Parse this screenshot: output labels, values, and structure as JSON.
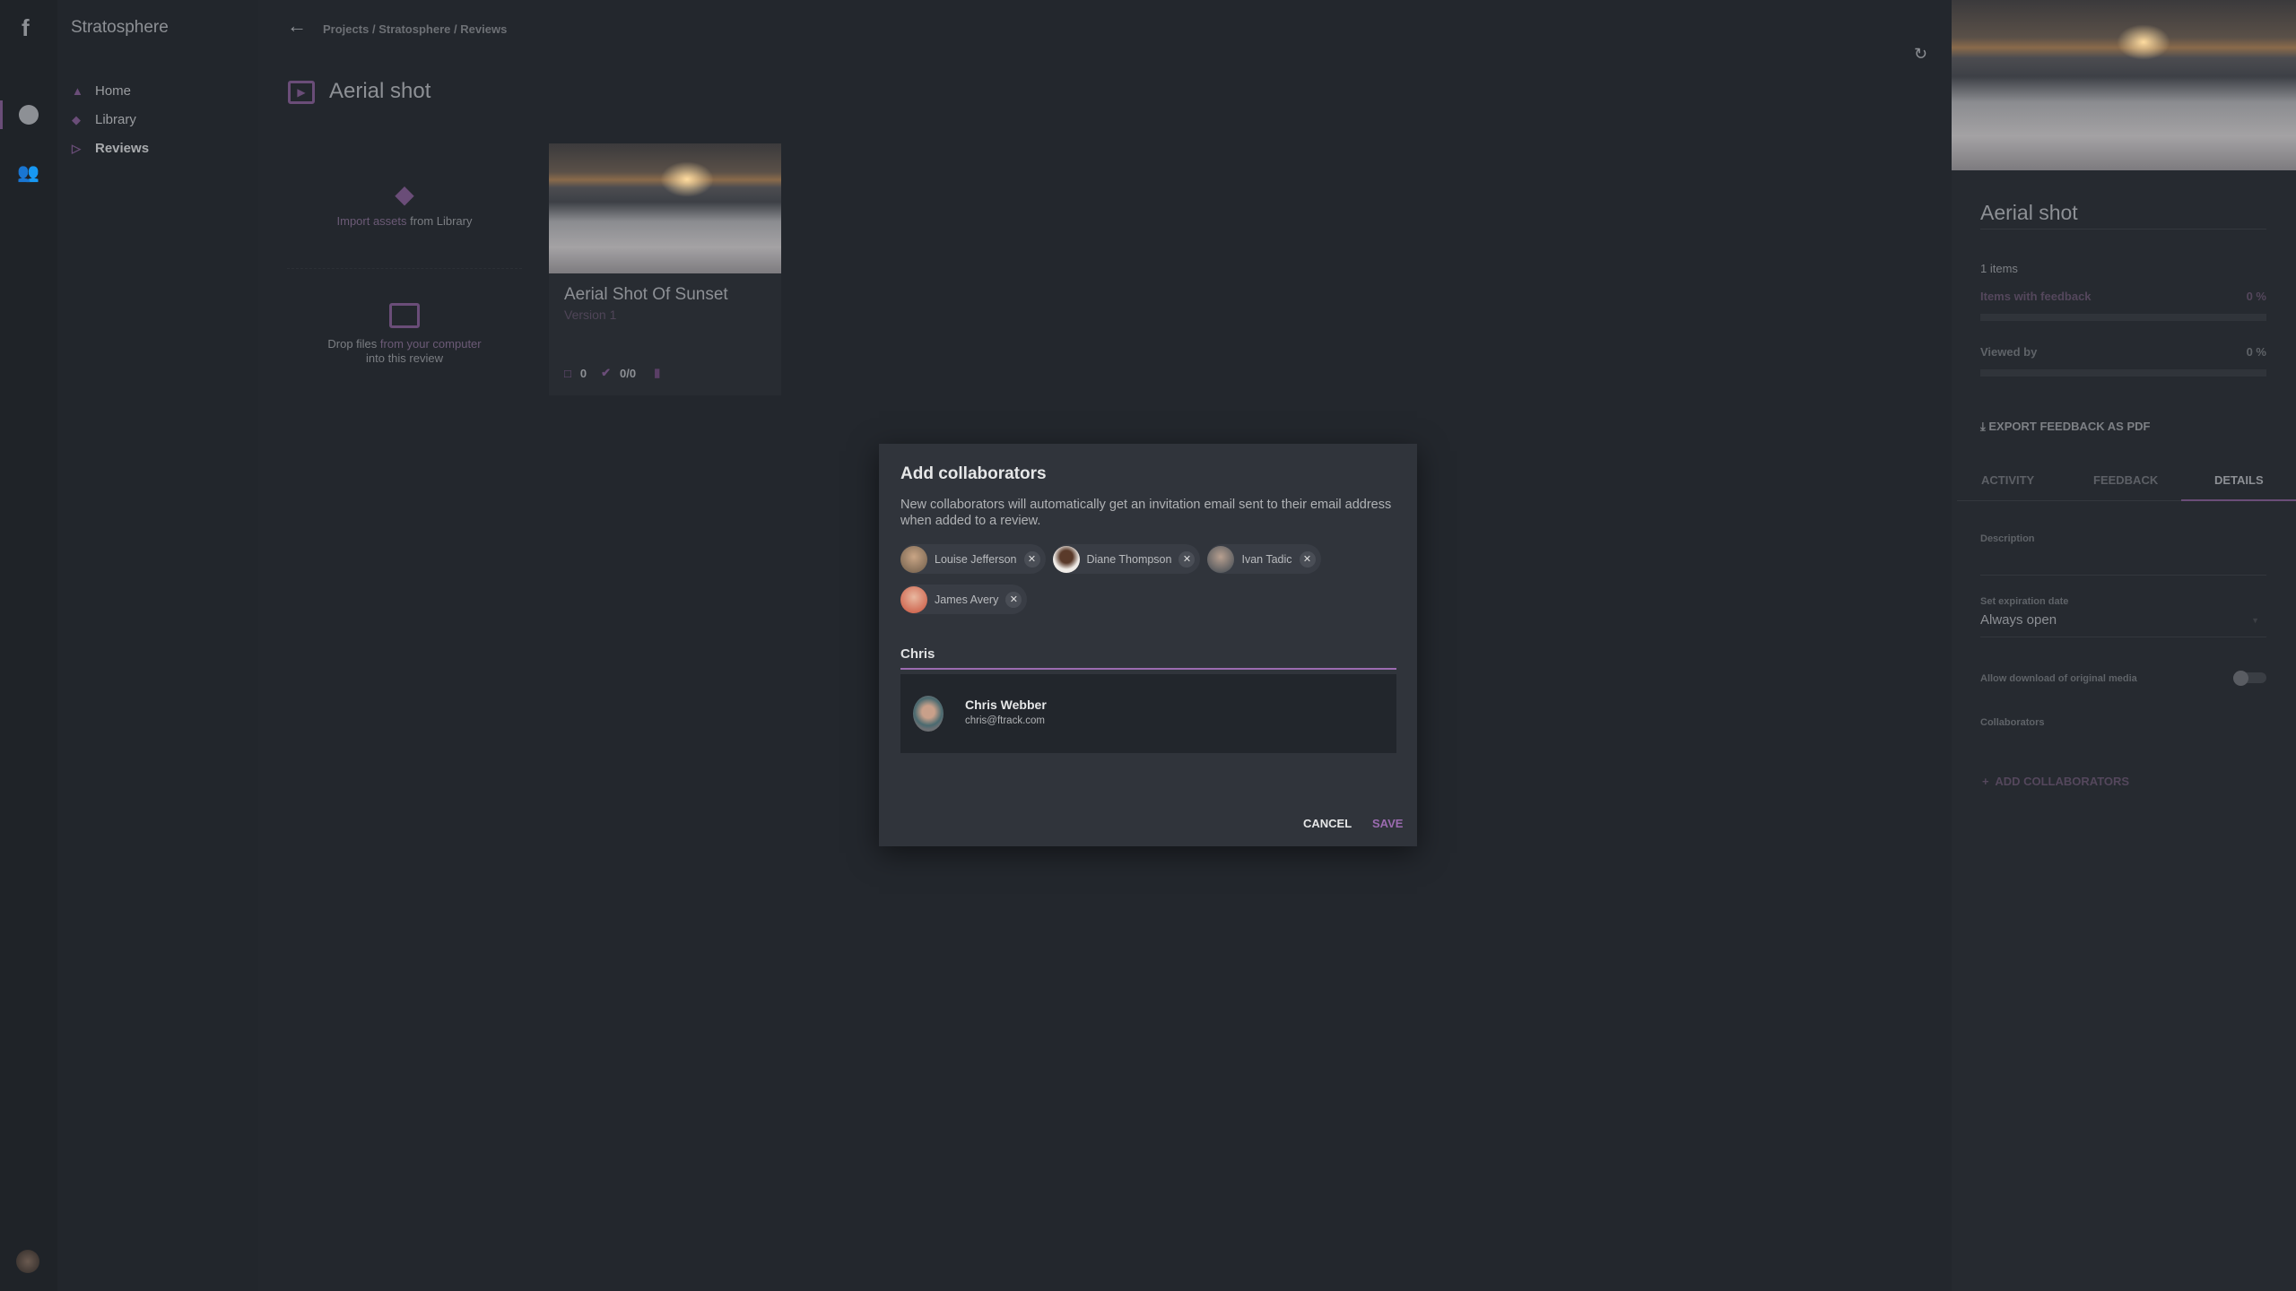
{
  "app": {
    "logo": "f",
    "project": "Stratosphere"
  },
  "rail": {
    "icons": [
      "circle-icon",
      "users-icon"
    ]
  },
  "sidebar": {
    "items": [
      {
        "label": "Home",
        "icon": "home-icon"
      },
      {
        "label": "Library",
        "icon": "layers-icon"
      },
      {
        "label": "Reviews",
        "icon": "review-icon",
        "active": true
      }
    ]
  },
  "breadcrumb": {
    "items": [
      "Projects",
      "Stratosphere",
      "Reviews"
    ],
    "sep": "/"
  },
  "page": {
    "title": "Aerial shot"
  },
  "import": {
    "link": "Import assets",
    "rest": " from Library"
  },
  "drop": {
    "pre": "Drop files ",
    "link": "from your computer",
    "post": "into this review"
  },
  "card": {
    "title": "Aerial Shot Of Sunset",
    "version": "Version 1",
    "comments": "0",
    "approvals": "0/0"
  },
  "panel": {
    "title": "Aerial shot",
    "items": "1 items",
    "feedback_label": "Items with feedback",
    "feedback_pct": "0 %",
    "feedback_value": 0,
    "viewed_label": "Viewed by",
    "viewed_pct": "0 %",
    "viewed_value": 0,
    "export": "EXPORT FEEDBACK AS PDF",
    "tabs": [
      "ACTIVITY",
      "FEEDBACK",
      "DETAILS"
    ],
    "active_tab": "DETAILS",
    "description_label": "Description",
    "expiration_label": "Set expiration date",
    "expiration_value": "Always open",
    "download_label": "Allow download of original media",
    "download_enabled": false,
    "collaborators_label": "Collaborators",
    "add_collaborators": "ADD COLLABORATORS"
  },
  "dialog": {
    "title": "Add collaborators",
    "description": "New collaborators will automatically get an invitation email sent to their email address when added to a review.",
    "chips": [
      "Louise Jefferson",
      "Diane Thompson",
      "Ivan Tadic",
      "James Avery"
    ],
    "input_value": "Chris",
    "suggestion": {
      "name": "Chris Webber",
      "email": "chris@ftrack.com"
    },
    "cancel": "CANCEL",
    "save": "SAVE"
  },
  "colors": {
    "accent": "#9b6bb0",
    "dialog_bg": "#30343b",
    "background": "#23272d"
  }
}
